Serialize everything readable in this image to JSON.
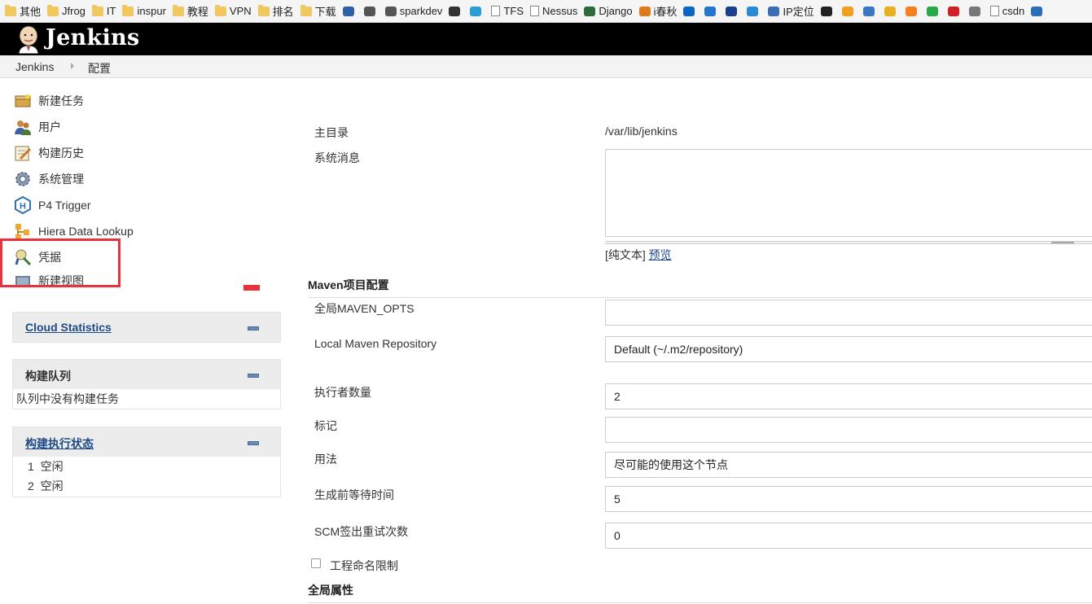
{
  "bookmarks": [
    {
      "label": "其他",
      "icon": "folder-icon"
    },
    {
      "label": "Jfrog",
      "icon": "folder-icon"
    },
    {
      "label": "IT",
      "icon": "folder-icon"
    },
    {
      "label": "inspur",
      "icon": "folder-icon"
    },
    {
      "label": "教程",
      "icon": "folder-icon"
    },
    {
      "label": "VPN",
      "icon": "folder-icon"
    },
    {
      "label": "排名",
      "icon": "folder-icon"
    },
    {
      "label": "下载",
      "icon": "folder-icon"
    },
    {
      "label": "",
      "icon": "gs-icon"
    },
    {
      "label": "",
      "icon": "swirl-icon"
    },
    {
      "label": "sparkdev",
      "icon": "swirl-icon"
    },
    {
      "label": "",
      "icon": "glyph-icon"
    },
    {
      "label": "",
      "icon": "star-icon"
    },
    {
      "label": "TFS",
      "icon": "page-icon"
    },
    {
      "label": "Nessus",
      "icon": "page-icon"
    },
    {
      "label": "Django",
      "icon": "django-icon"
    },
    {
      "label": "i春秋",
      "icon": "ichunqiu-icon"
    },
    {
      "label": "",
      "icon": "zhihu-icon"
    },
    {
      "label": "",
      "icon": "diamond-icon"
    },
    {
      "label": "",
      "icon": "e-icon"
    },
    {
      "label": "",
      "icon": "feather-icon"
    },
    {
      "label": "IP定位",
      "icon": "ip-icon"
    },
    {
      "label": "",
      "icon": "u-icon"
    },
    {
      "label": "",
      "icon": "uc-icon"
    },
    {
      "label": "",
      "icon": "paw-icon"
    },
    {
      "label": "",
      "icon": "coin-icon"
    },
    {
      "label": "",
      "icon": "stack-icon"
    },
    {
      "label": "",
      "icon": "c-icon"
    },
    {
      "label": "",
      "icon": "oracle-icon"
    },
    {
      "label": "",
      "icon": "wrench-icon"
    },
    {
      "label": "csdn",
      "icon": "page-icon"
    },
    {
      "label": "",
      "icon": "infoq-icon"
    }
  ],
  "header": {
    "brand": "Jenkins"
  },
  "breadcrumb": {
    "root": "Jenkins",
    "current": "配置"
  },
  "tasks": [
    {
      "label": "新建任务",
      "icon": "new-item-icon"
    },
    {
      "label": "用户",
      "icon": "users-icon"
    },
    {
      "label": "构建历史",
      "icon": "build-history-icon"
    },
    {
      "label": "系统管理",
      "icon": "gear-icon"
    },
    {
      "label": "P4 Trigger",
      "icon": "p4-trigger-icon"
    },
    {
      "label": "Hiera Data Lookup",
      "icon": "hiera-icon"
    },
    {
      "label": "凭据",
      "icon": "credentials-icon"
    },
    {
      "label": "新建视图",
      "icon": "new-view-icon"
    }
  ],
  "panels": {
    "cloud_statistics": {
      "title": "Cloud Statistics"
    },
    "build_queue": {
      "title": "构建队列",
      "empty": "队列中没有构建任务"
    },
    "executors": {
      "title": "构建执行状态",
      "rows": [
        {
          "num": "1",
          "status": "空闲"
        },
        {
          "num": "2",
          "status": "空闲"
        }
      ]
    }
  },
  "form": {
    "home_dir": {
      "label": "主目录",
      "value": "/var/lib/jenkins"
    },
    "system_message": {
      "label": "系统消息",
      "value": "",
      "plain_text": "[纯文本]",
      "preview": "预览"
    },
    "maven_section": "Maven项目配置",
    "maven_opts": {
      "label": "全局MAVEN_OPTS",
      "value": ""
    },
    "local_repo": {
      "label": "Local Maven Repository",
      "value": "Default (~/.m2/repository)"
    },
    "executors": {
      "label": "执行者数量",
      "value": "2"
    },
    "labels": {
      "label": "标记",
      "value": ""
    },
    "usage": {
      "label": "用法",
      "value": "尽可能的使用这个节点"
    },
    "quiet_period": {
      "label": "生成前等待时间",
      "value": "5"
    },
    "scm_retry": {
      "label": "SCM签出重试次数",
      "value": "0"
    },
    "naming_restrict": {
      "label": "工程命名限制",
      "checked": false
    },
    "global_props_section": "全局属性"
  },
  "colors": {
    "header_bg": "#000000",
    "link": "#204a87",
    "highlight": "#e8323c"
  }
}
